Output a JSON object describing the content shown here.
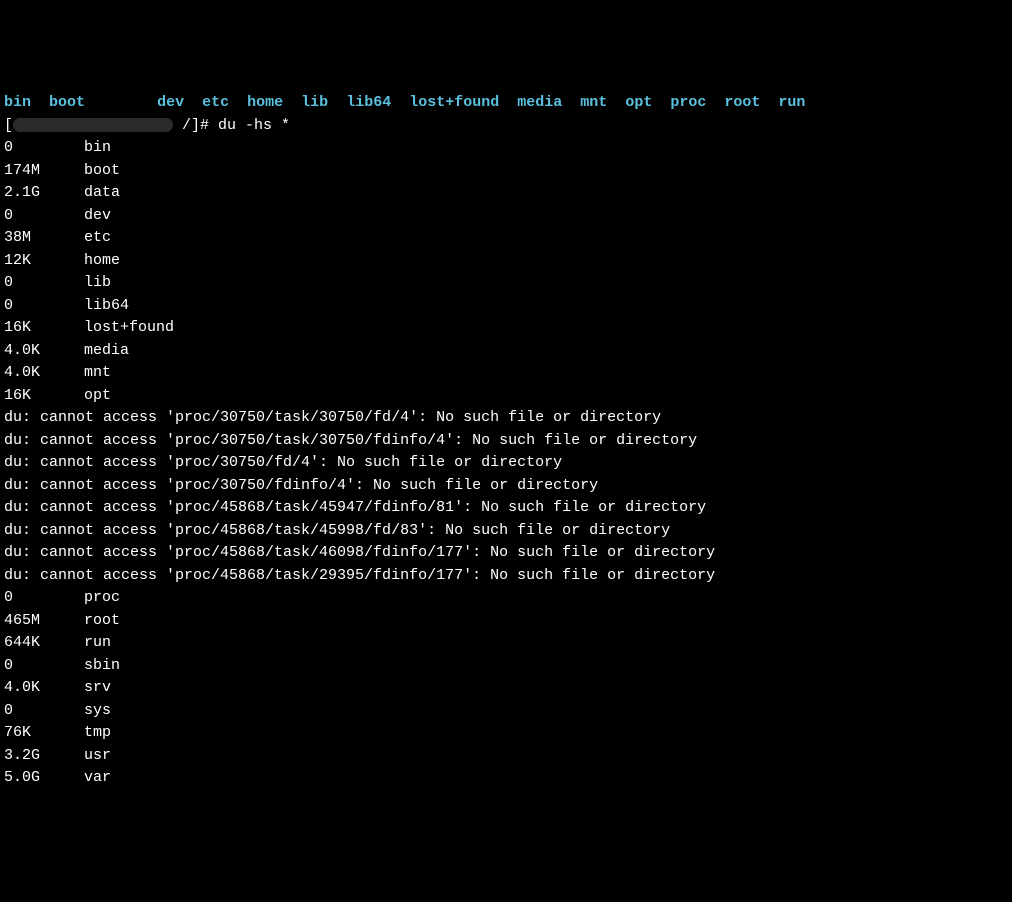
{
  "top_partial": {
    "words": [
      "bin",
      "boot",
      "dev",
      "etc",
      "home",
      "lib",
      "lib64",
      "lost+found",
      "media",
      "mnt",
      "opt",
      "proc",
      "root",
      "run"
    ]
  },
  "prompt": {
    "prefix": "[",
    "suffix": " /]# ",
    "command": "du -hs *"
  },
  "rows_before": [
    {
      "size": "0",
      "name": "bin"
    },
    {
      "size": "174M",
      "name": "boot"
    },
    {
      "size": "2.1G",
      "name": "data"
    },
    {
      "size": "0",
      "name": "dev"
    },
    {
      "size": "38M",
      "name": "etc"
    },
    {
      "size": "12K",
      "name": "home"
    },
    {
      "size": "0",
      "name": "lib"
    },
    {
      "size": "0",
      "name": "lib64"
    },
    {
      "size": "16K",
      "name": "lost+found"
    },
    {
      "size": "4.0K",
      "name": "media"
    },
    {
      "size": "4.0K",
      "name": "mnt"
    },
    {
      "size": "16K",
      "name": "opt"
    }
  ],
  "errors": [
    "du: cannot access 'proc/30750/task/30750/fd/4': No such file or directory",
    "du: cannot access 'proc/30750/task/30750/fdinfo/4': No such file or directory",
    "du: cannot access 'proc/30750/fd/4': No such file or directory",
    "du: cannot access 'proc/30750/fdinfo/4': No such file or directory",
    "du: cannot access 'proc/45868/task/45947/fdinfo/81': No such file or directory",
    "du: cannot access 'proc/45868/task/45998/fd/83': No such file or directory",
    "du: cannot access 'proc/45868/task/46098/fdinfo/177': No such file or directory",
    "du: cannot access 'proc/45868/task/29395/fdinfo/177': No such file or directory"
  ],
  "rows_after": [
    {
      "size": "0",
      "name": "proc"
    },
    {
      "size": "465M",
      "name": "root"
    },
    {
      "size": "644K",
      "name": "run"
    },
    {
      "size": "0",
      "name": "sbin"
    },
    {
      "size": "4.0K",
      "name": "srv"
    },
    {
      "size": "0",
      "name": "sys"
    },
    {
      "size": "76K",
      "name": "tmp"
    },
    {
      "size": "3.2G",
      "name": "usr"
    },
    {
      "size": "5.0G",
      "name": "var"
    }
  ]
}
